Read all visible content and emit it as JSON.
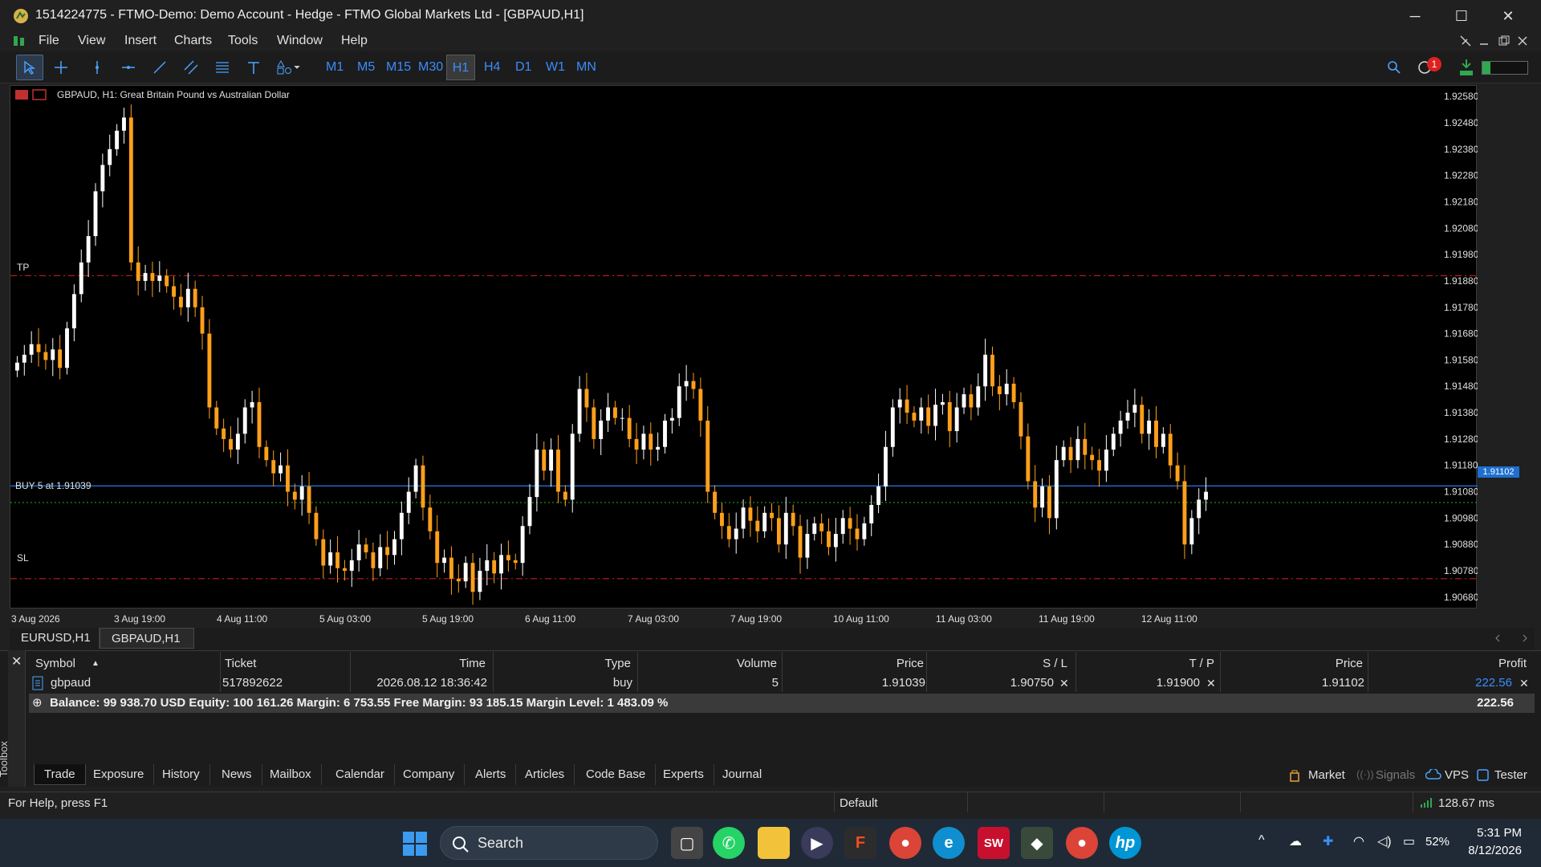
{
  "window": {
    "title": "1514224775 - FTMO-Demo: Demo Account - Hedge - FTMO Global Markets Ltd - [GBPAUD,H1]",
    "minimize": "─",
    "maximize": "☐",
    "close": "✕"
  },
  "menu": [
    "File",
    "View",
    "Insert",
    "Charts",
    "Tools",
    "Window",
    "Help"
  ],
  "timeframes": [
    "M1",
    "M5",
    "M15",
    "M30",
    "H1",
    "H4",
    "D1",
    "W1",
    "MN"
  ],
  "active_timeframe": "H1",
  "notification_count": "1",
  "chart": {
    "header": "GBPAUD, H1:  Great Britain Pound vs Australian Dollar",
    "tp_label": "TP",
    "sl_label": "SL",
    "position_label": "BUY 5 at 1.91039",
    "current_price_tag": "1.91102",
    "colors": {
      "bull": "#ffffff",
      "bear": "#ff9f1a",
      "tp_sl": "#e02020",
      "bid": "#1e6fd0",
      "entry": "#1bb41b"
    }
  },
  "chart_data": {
    "type": "candlestick",
    "symbol": "GBPAUD",
    "timeframe": "H1",
    "y_ticks": [
      "1.92580",
      "1.92480",
      "1.92380",
      "1.92280",
      "1.92180",
      "1.92080",
      "1.91980",
      "1.91880",
      "1.91780",
      "1.91680",
      "1.91580",
      "1.91480",
      "1.91380",
      "1.91280",
      "1.91180",
      "1.91080",
      "1.90980",
      "1.90880",
      "1.90780",
      "1.90680"
    ],
    "x_ticks": [
      "3 Aug 2026",
      "3 Aug 19:00",
      "4 Aug 11:00",
      "5 Aug 03:00",
      "5 Aug 19:00",
      "6 Aug 11:00",
      "7 Aug 03:00",
      "7 Aug 19:00",
      "10 Aug 11:00",
      "11 Aug 03:00",
      "11 Aug 19:00",
      "12 Aug 11:00"
    ],
    "ylim": [
      1.9064,
      1.9262
    ],
    "levels": {
      "tp": 1.919,
      "sl": 1.9075,
      "entry": 1.91039,
      "bid": 1.91102
    },
    "closes": [
      1.9157,
      1.916,
      1.9164,
      1.9161,
      1.9158,
      1.9162,
      1.9155,
      1.917,
      1.9183,
      1.9195,
      1.9205,
      1.9222,
      1.9232,
      1.9238,
      1.9245,
      1.925,
      1.9195,
      1.9188,
      1.9191,
      1.9188,
      1.919,
      1.9186,
      1.9182,
      1.9178,
      1.9185,
      1.9178,
      1.9168,
      1.914,
      1.9132,
      1.9128,
      1.9124,
      1.913,
      1.914,
      1.9142,
      1.9125,
      1.912,
      1.9115,
      1.9118,
      1.9108,
      1.9105,
      1.911,
      1.91,
      1.909,
      1.908,
      1.9085,
      1.9079,
      1.9078,
      1.9082,
      1.9088,
      1.9085,
      1.9079,
      1.9087,
      1.9084,
      1.909,
      1.91,
      1.9108,
      1.9118,
      1.9102,
      1.9093,
      1.9081,
      1.9083,
      1.9075,
      1.9074,
      1.9081,
      1.907,
      1.9078,
      1.9082,
      1.9077,
      1.9084,
      1.9082,
      1.9081,
      1.9095,
      1.9106,
      1.9124,
      1.9116,
      1.9124,
      1.9108,
      1.9105,
      1.913,
      1.9147,
      1.914,
      1.9128,
      1.9135,
      1.914,
      1.9136,
      1.9136,
      1.9128,
      1.9124,
      1.913,
      1.9124,
      1.9125,
      1.9135,
      1.9136,
      1.9148,
      1.915,
      1.9147,
      1.9135,
      1.9108,
      1.91,
      1.9095,
      1.909,
      1.9094,
      1.9102,
      1.9097,
      1.9093,
      1.91,
      1.9098,
      1.9088,
      1.91,
      1.9095,
      1.9083,
      1.9092,
      1.9096,
      1.9093,
      1.9087,
      1.9092,
      1.9098,
      1.9094,
      1.909,
      1.9096,
      1.9103,
      1.911,
      1.9125,
      1.914,
      1.9143,
      1.9138,
      1.9135,
      1.914,
      1.9133,
      1.9141,
      1.9142,
      1.9131,
      1.914,
      1.9145,
      1.914,
      1.9148,
      1.916,
      1.9148,
      1.9145,
      1.9149,
      1.9142,
      1.9129,
      1.9112,
      1.9102,
      1.911,
      1.9098,
      1.912,
      1.9125,
      1.912,
      1.9128,
      1.9122,
      1.912,
      1.9116,
      1.9124,
      1.913,
      1.9135,
      1.9138,
      1.9141,
      1.913,
      1.9135,
      1.9125,
      1.913,
      1.9118,
      1.9112,
      1.9088,
      1.9098,
      1.9105,
      1.9108
    ]
  },
  "chart_tabs": [
    "EURUSD,H1",
    "GBPAUD,H1"
  ],
  "active_chart_tab": "GBPAUD,H1",
  "trade": {
    "headers": [
      "Symbol",
      "Ticket",
      "Time",
      "Type",
      "Volume",
      "Price",
      "S / L",
      "T / P",
      "Price",
      "Profit"
    ],
    "row": {
      "symbol": "gbpaud",
      "ticket": "517892622",
      "time": "2026.08.12 18:36:42",
      "type": "buy",
      "volume": "5",
      "price": "1.91039",
      "sl": "1.90750",
      "tp": "1.91900",
      "current_price": "1.91102",
      "profit": "222.56"
    },
    "balance_line": "Balance: 99 938.70 USD  Equity: 100 161.26  Margin: 6 753.55  Free Margin: 93 185.15  Margin Level: 1 483.09 %",
    "total_profit": "222.56"
  },
  "toolbox_label": "Toolbox",
  "bottom_tabs": [
    "Trade",
    "Exposure",
    "History",
    "News",
    "Mailbox",
    "Calendar",
    "Company",
    "Alerts",
    "Articles",
    "Code Base",
    "Experts",
    "Journal"
  ],
  "active_bottom_tab": "Trade",
  "bottom_right": {
    "market": "Market",
    "signals": "Signals",
    "vps": "VPS",
    "tester": "Tester"
  },
  "status": {
    "help": "For Help, press F1",
    "profile": "Default",
    "ping": "128.67 ms"
  },
  "taskbar": {
    "search_label": "Search",
    "battery": "52%",
    "time": "5:31 PM",
    "date": "8/12/2026"
  }
}
